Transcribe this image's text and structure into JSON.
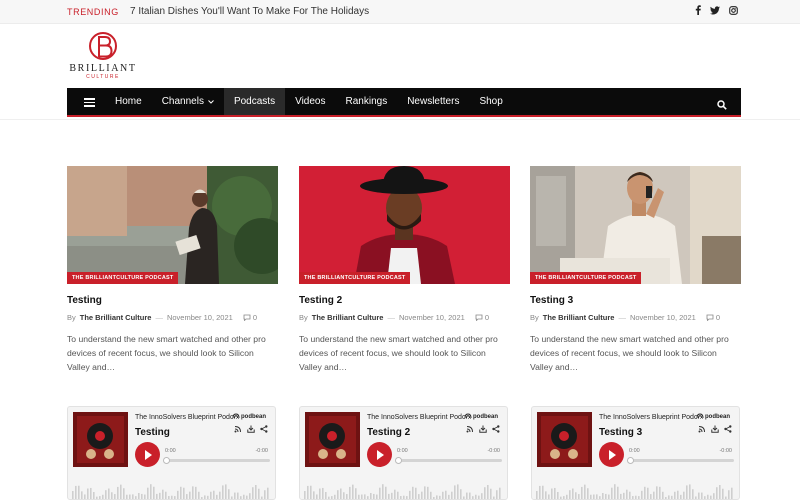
{
  "topbar": {
    "trending_label": "TRENDING",
    "trending_headline": "7 Italian Dishes You'll Want To Make For The Holidays",
    "social_icons": [
      "facebook-icon",
      "twitter-icon",
      "instagram-icon"
    ]
  },
  "logo": {
    "monogram": "B",
    "word": "BRILLIANT",
    "sub": "CULTURE"
  },
  "nav": {
    "items": [
      {
        "label": "Home"
      },
      {
        "label": "Channels",
        "has_dropdown": true
      },
      {
        "label": "Podcasts",
        "active": true
      },
      {
        "label": "Videos"
      },
      {
        "label": "Rankings"
      },
      {
        "label": "Newsletters"
      },
      {
        "label": "Shop"
      }
    ],
    "icons": [
      "menu-icon",
      "search-icon"
    ]
  },
  "cards": [
    {
      "category": "THE BRILLIANTCULTURE PODCAST",
      "title": "Testing",
      "by": "By",
      "author": "The Brilliant Culture",
      "date": "November 10, 2021",
      "comments": "0",
      "excerpt": "To understand the new smart watched and other pro devices of recent focus, we should look to Silicon Valley and…"
    },
    {
      "category": "THE BRILLIANTCULTURE PODCAST",
      "title": "Testing 2",
      "by": "By",
      "author": "The Brilliant Culture",
      "date": "November 10, 2021",
      "comments": "0",
      "excerpt": "To understand the new smart watched and other pro devices of recent focus, we should look to Silicon Valley and…"
    },
    {
      "category": "THE BRILLIANTCULTURE PODCAST",
      "title": "Testing 3",
      "by": "By",
      "author": "The Brilliant Culture",
      "date": "November 10, 2021",
      "comments": "0",
      "excerpt": "To understand the new smart watched and other pro devices of recent focus, we should look to Silicon Valley and…"
    }
  ],
  "players": [
    {
      "show": "The InnoSolvers Blueprint Podc...",
      "brand": "podbean",
      "episode": "Testing",
      "time_current": "0:00",
      "time_remaining": "-0:00",
      "progress": 0
    },
    {
      "show": "The InnoSolvers Blueprint Podc...",
      "brand": "podbean",
      "episode": "Testing 2",
      "time_current": "0:00",
      "time_remaining": "-0:00",
      "progress": 0
    },
    {
      "show": "The InnoSolvers Blueprint Podc...",
      "brand": "podbean",
      "episode": "Testing 3",
      "time_current": "0:00",
      "time_remaining": "-0:00",
      "progress": 0
    }
  ],
  "colors": {
    "accent": "#c9202a",
    "nav_bg": "#0b0b0b",
    "nav_active_bg": "#2a2a2a",
    "topbar_bg": "#f7f7f7"
  }
}
